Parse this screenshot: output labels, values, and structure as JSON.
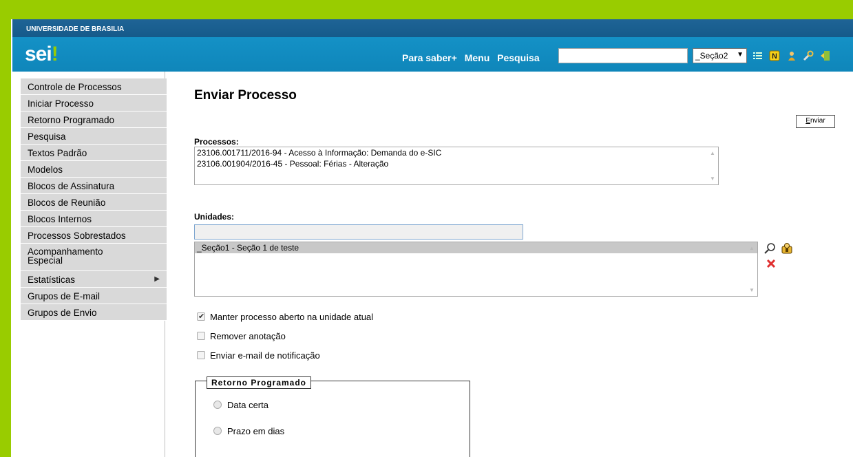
{
  "header": {
    "university": "UNIVERSIDADE DE BRASILIA",
    "logo": "sei",
    "logo_mark": "!",
    "nav": [
      "Para saber+",
      "Menu",
      "Pesquisa"
    ],
    "unit_selected": "_Seção2",
    "icons": [
      "list-icon",
      "notes-icon",
      "user-icon",
      "wrench-icon",
      "exit-icon"
    ]
  },
  "sidebar": {
    "items": [
      {
        "label": "Controle de Processos"
      },
      {
        "label": "Iniciar Processo"
      },
      {
        "label": "Retorno Programado"
      },
      {
        "label": "Pesquisa"
      },
      {
        "label": "Textos Padrão"
      },
      {
        "label": "Modelos"
      },
      {
        "label": "Blocos de Assinatura"
      },
      {
        "label": "Blocos de Reunião"
      },
      {
        "label": "Blocos Internos"
      },
      {
        "label": "Processos Sobrestados"
      },
      {
        "label": "Acompanhamento Especial"
      },
      {
        "label": "Estatísticas"
      },
      {
        "label": "Grupos de E-mail"
      },
      {
        "label": "Grupos de Envio"
      }
    ]
  },
  "page": {
    "title": "Enviar Processo",
    "send_button": "Enviar",
    "processes_label": "Processos:",
    "processes": [
      "23106.001711/2016-94 - Acesso à Informação: Demanda do e-SIC",
      "23106.001904/2016-45 - Pessoal: Férias - Alteração"
    ],
    "units_label": "Unidades:",
    "units_input_value": "",
    "units": [
      "_Seção1 - Seção 1 de teste"
    ],
    "options": [
      {
        "label": "Manter processo aberto na unidade atual",
        "checked": true
      },
      {
        "label": "Remover anotação",
        "checked": false
      },
      {
        "label": "Enviar e-mail de notificação",
        "checked": false
      }
    ],
    "return_legend": "Retorno Programado",
    "return_options": [
      "Data certa",
      "Prazo em dias"
    ]
  },
  "colors": {
    "frame": "#99cc00",
    "topbar": "#155a8a",
    "mainbar": "#1491c6",
    "sidebar_bg": "#d9d9d9"
  }
}
